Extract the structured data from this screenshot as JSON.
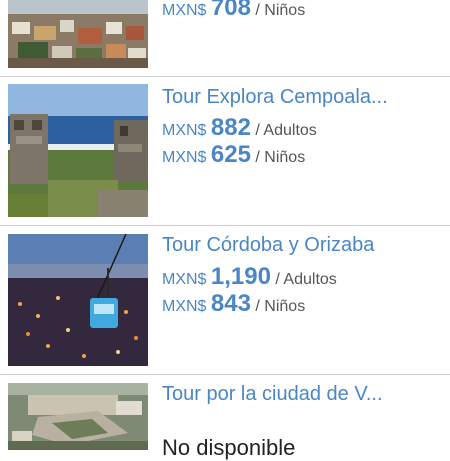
{
  "items": [
    {
      "title": "",
      "prices": [
        {
          "currency": "MXN$",
          "amount": "708",
          "label": "/ Niños"
        }
      ],
      "image": "city-colonial-rooftops-photo"
    },
    {
      "title": "Tour Explora Cempoala...",
      "prices": [
        {
          "currency": "MXN$",
          "amount": "882",
          "label": "/ Adultos"
        },
        {
          "currency": "MXN$",
          "amount": "625",
          "label": "/ Niños"
        }
      ],
      "image": "cempoala-ruins-sea-photo"
    },
    {
      "title": "Tour Córdoba y Orizaba",
      "prices": [
        {
          "currency": "MXN$",
          "amount": "1,190",
          "label": "/ Adultos"
        },
        {
          "currency": "MXN$",
          "amount": "843",
          "label": "/ Niños"
        }
      ],
      "image": "orizaba-cable-car-night-photo"
    },
    {
      "title": "Tour por la ciudad de V...",
      "status": "No disponible",
      "image": "veracruz-fort-aerial-photo"
    }
  ],
  "colors": {
    "accent": "#4a86c5",
    "divider": "#cfcfcf"
  }
}
